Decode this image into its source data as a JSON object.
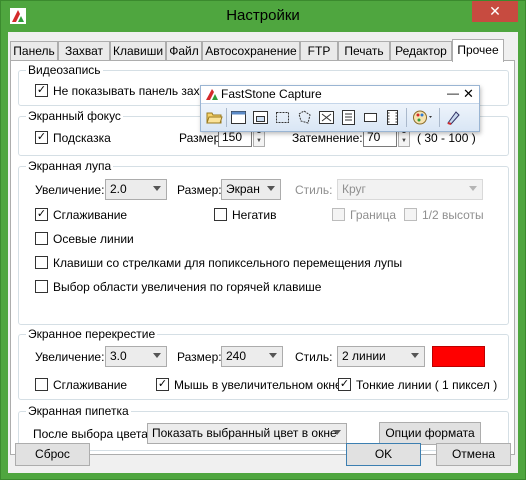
{
  "window": {
    "title": "Настройки",
    "close_glyph": "✕",
    "app_icon": "fs-capture-app-icon"
  },
  "tabs": [
    {
      "label": "Панель"
    },
    {
      "label": "Захват"
    },
    {
      "label": "Клавиши"
    },
    {
      "label": "Файл"
    },
    {
      "label": "Автосохранение"
    },
    {
      "label": "FTP"
    },
    {
      "label": "Печать"
    },
    {
      "label": "Редактор"
    },
    {
      "label": "Прочее",
      "active": true
    }
  ],
  "video": {
    "legend": "Видеозапись",
    "hide_panel_label": "Не показывать панель захвата",
    "hide_panel_checked": true
  },
  "focus": {
    "legend": "Экранный фокус",
    "tooltip_label": "Подсказка",
    "tooltip_checked": true,
    "size_label": "Размер:",
    "size_value": "150",
    "dim_label": "Затемнение:",
    "dim_value": "70",
    "dim_range": "( 30 - 100 )"
  },
  "loupe": {
    "legend": "Экранная лупа",
    "zoom_label": "Увеличение:",
    "zoom_value": "2.0",
    "size_label": "Размер:",
    "size_value": "Экран",
    "style_label": "Стиль:",
    "style_value": "Круг",
    "smoothing_label": "Сглаживание",
    "smoothing_checked": true,
    "negative_label": "Негатив",
    "negative_checked": false,
    "border_label": "Граница",
    "half_height_label": "1/2 высоты",
    "axes_label": "Осевые линии",
    "axes_checked": false,
    "arrow_keys_label": "Клавиши со стрелками для попиксельного перемещения лупы",
    "arrow_keys_checked": false,
    "hotkey_select_label": "Выбор области увеличения по горячей клавише",
    "hotkey_select_checked": false
  },
  "crosshair": {
    "legend": "Экранное перекрестие",
    "zoom_label": "Увеличение:",
    "zoom_value": "3.0",
    "size_label": "Размер:",
    "size_value": "240",
    "style_label": "Стиль:",
    "style_value": "2 линии",
    "color": "#ff0000",
    "smoothing_label": "Сглаживание",
    "smoothing_checked": false,
    "mouse_in_window_label": "Мышь в увеличительном окне",
    "mouse_in_window_checked": true,
    "thin_lines_label": "Тонкие линии ( 1 пиксел )",
    "thin_lines_checked": true
  },
  "pipette": {
    "legend": "Экранная пипетка",
    "after_pick_label": "После выбора цвета:",
    "after_pick_value": "Показать выбранный цвет в окне",
    "format_button": "Опции формата"
  },
  "footer": {
    "reset": "Сброс",
    "ok": "OK",
    "cancel": "Отмена"
  },
  "floating_toolbar": {
    "title": "FastStone Capture",
    "minimize_glyph": "—",
    "close_glyph": "✕",
    "tools": [
      "open-file-icon",
      "capture-active-window-icon",
      "capture-window-object-icon",
      "capture-rectangle-icon",
      "capture-freehand-icon",
      "capture-fullscreen-icon",
      "capture-scrolling-icon",
      "capture-fixed-region-icon",
      "screen-recorder-icon",
      "output-destination-icon",
      "settings-icon"
    ]
  },
  "colors": {
    "window_frame": "#4fa63f",
    "close_button": "#c74b40",
    "accent": "#3c7fb1"
  }
}
